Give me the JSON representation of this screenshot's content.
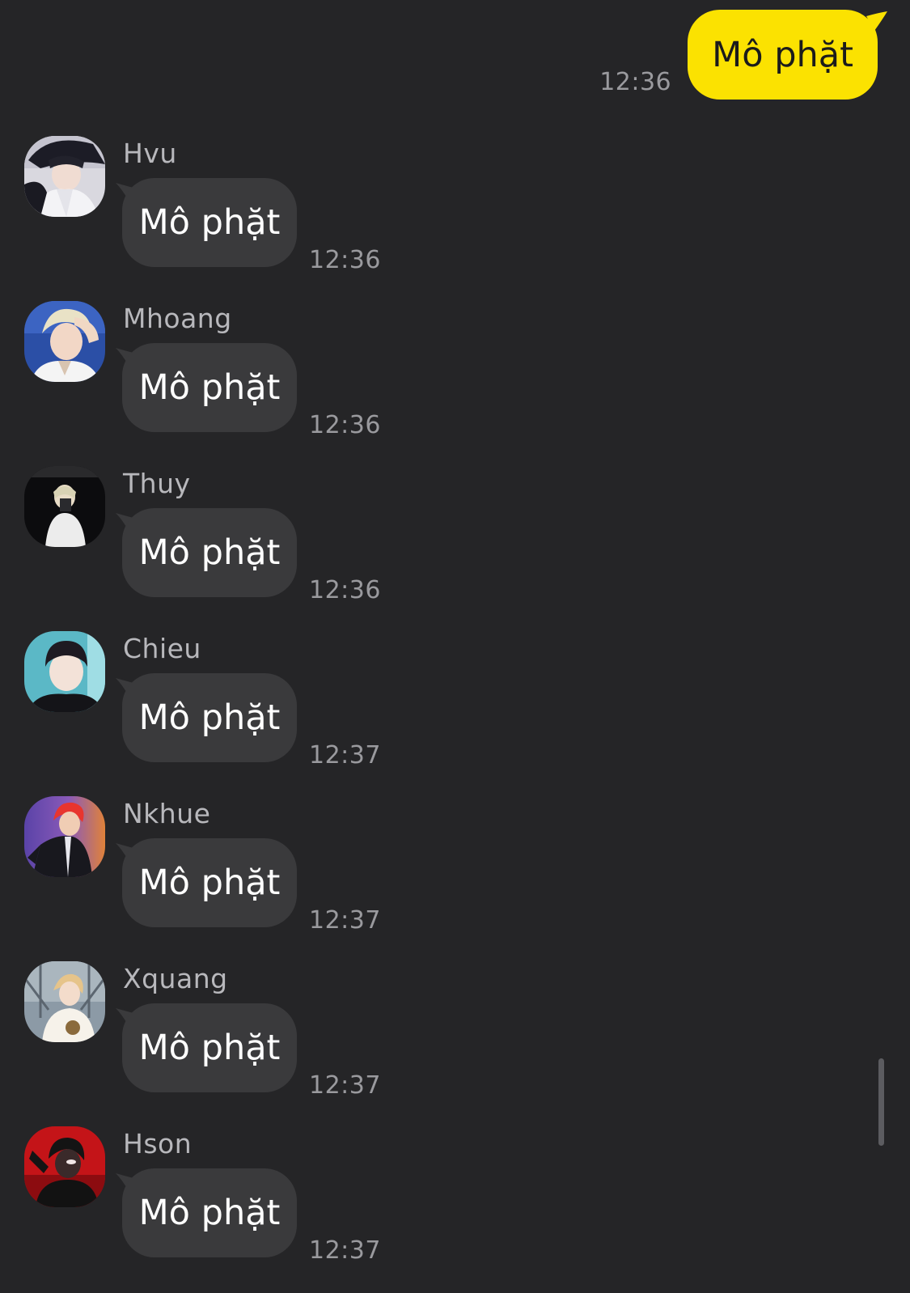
{
  "outgoing": {
    "text": "Mô phặt",
    "time": "12:36",
    "bubble_color": "#fbe201"
  },
  "messages": [
    {
      "sender": "Hvu",
      "text": "Mô phặt",
      "time": "12:36"
    },
    {
      "sender": "Mhoang",
      "text": "Mô phặt",
      "time": "12:36"
    },
    {
      "sender": "Thuy",
      "text": "Mô phặt",
      "time": "12:36"
    },
    {
      "sender": "Chieu",
      "text": "Mô phặt",
      "time": "12:37"
    },
    {
      "sender": "Nkhue",
      "text": "Mô phặt",
      "time": "12:37"
    },
    {
      "sender": "Xquang",
      "text": "Mô phặt",
      "time": "12:37"
    },
    {
      "sender": "Hson",
      "text": "Mô phặt",
      "time": "12:37"
    }
  ],
  "colors": {
    "background": "#252527",
    "incoming_bubble": "#3a3a3c",
    "outgoing_bubble": "#fbe201"
  }
}
